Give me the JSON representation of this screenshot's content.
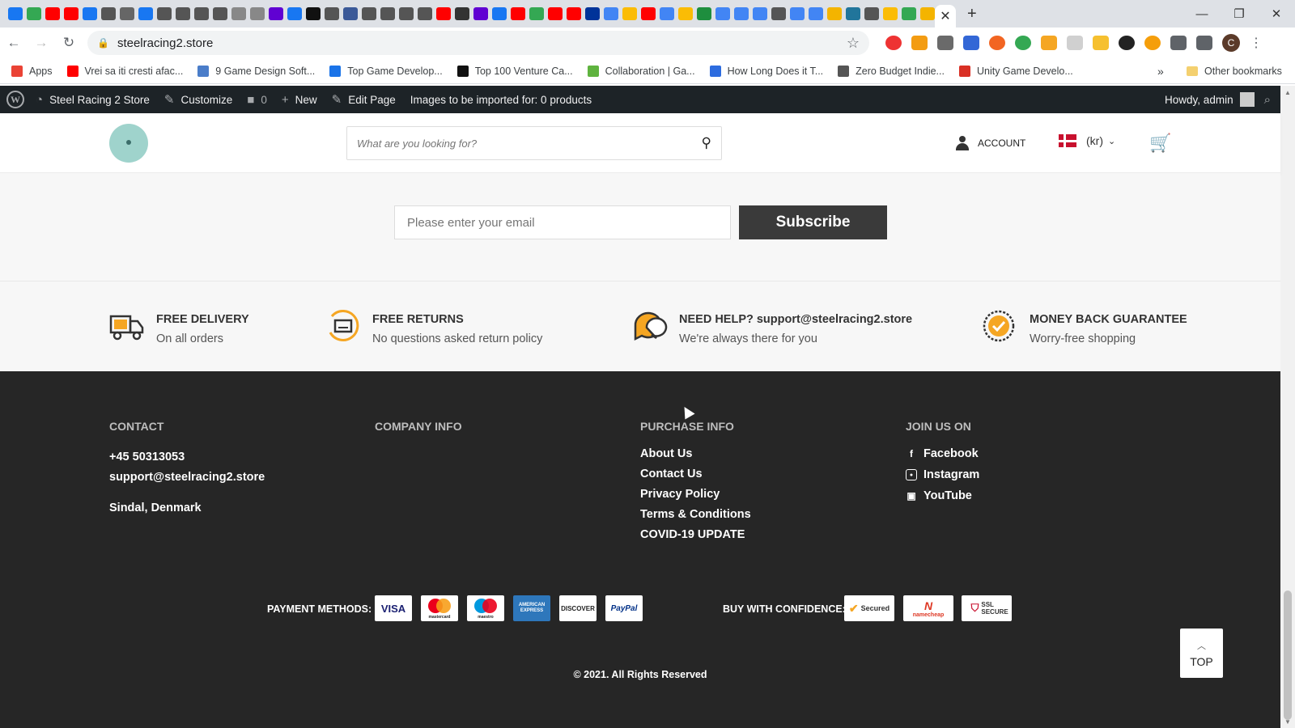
{
  "browser": {
    "tab_close": "✕",
    "new_tab": "+",
    "window_controls": [
      "—",
      "❐",
      "✕"
    ],
    "address": "steelracing2.store",
    "profile_initial": "C",
    "bookmarks": [
      {
        "label": "Apps",
        "color": "#ea4335"
      },
      {
        "label": "Vrei sa iti cresti afac...",
        "color": "#ff0000"
      },
      {
        "label": "9 Game Design Soft...",
        "color": "#4a7dc9"
      },
      {
        "label": "Top Game Develop...",
        "color": "#1a73e8"
      },
      {
        "label": "Top 100 Venture Ca...",
        "color": "#111111"
      },
      {
        "label": "Collaboration | Ga...",
        "color": "#5fb33f"
      },
      {
        "label": "How Long Does it T...",
        "color": "#2d6cdf"
      },
      {
        "label": "Zero Budget Indie...",
        "color": "#555555"
      },
      {
        "label": "Unity Game Develo...",
        "color": "#d93025"
      }
    ],
    "bookmarks_more": "»",
    "other_bookmarks": "Other bookmarks"
  },
  "admin_bar": {
    "site_name": "Steel Racing 2 Store",
    "customize": "Customize",
    "comments_count": "0",
    "new": "New",
    "edit_page": "Edit Page",
    "images_notice": "Images to be imported for: 0 products",
    "howdy": "Howdy, admin"
  },
  "header": {
    "search_placeholder": "What are you looking for?",
    "account": "ACCOUNT",
    "currency": "(kr)"
  },
  "newsletter": {
    "email_placeholder": "Please enter your email",
    "subscribe": "Subscribe"
  },
  "features": [
    {
      "title": "FREE DELIVERY",
      "subtitle": "On all orders"
    },
    {
      "title": "FREE RETURNS",
      "subtitle": "No questions asked return policy"
    },
    {
      "title": "NEED HELP? support@steelracing2.store",
      "subtitle": "We're always there for you"
    },
    {
      "title": "MONEY BACK GUARANTEE",
      "subtitle": "Worry-free shopping"
    }
  ],
  "footer": {
    "contact": {
      "heading": "CONTACT",
      "phone": "+45 50313053",
      "email": "support@steelracing2.store",
      "location": "Sindal, Denmark"
    },
    "company_info": {
      "heading": "COMPANY INFO"
    },
    "purchase_info": {
      "heading": "PURCHASE INFO",
      "links": [
        "About Us",
        "Contact Us",
        "Privacy Policy",
        "Terms & Conditions",
        "COVID-19 UPDATE"
      ]
    },
    "join_us": {
      "heading": "JOIN US ON",
      "links": [
        "Facebook",
        "Instagram",
        "YouTube"
      ]
    },
    "payment_label": "PAYMENT METHODS:",
    "payment_cards": [
      "VISA",
      "mastercard",
      "maestro",
      "AMERICAN EXPRESS",
      "DISCOVER",
      "PayPal"
    ],
    "confidence_label": "BUY WITH CONFIDENCE:",
    "confidence_badges": [
      "Secured",
      "namecheap",
      "SSL SECURE"
    ],
    "copyright": "© 2021. All Rights Reserved",
    "top_button": "TOP"
  },
  "colors": {
    "accent_orange": "#f5a623",
    "admin_bar": "#1d2327",
    "footer_bg": "#262626",
    "feature_bg": "#f7f7f7"
  }
}
